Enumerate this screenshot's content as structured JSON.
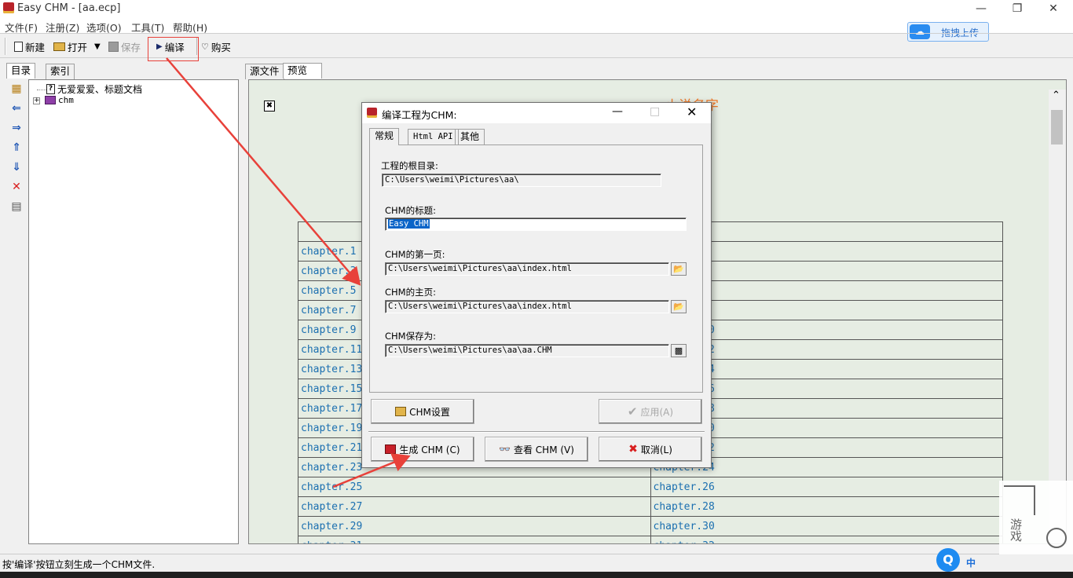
{
  "window": {
    "title": "Easy CHM - [aa.ecp]",
    "min": "—",
    "restore": "❐",
    "close": "✕"
  },
  "menu": [
    "文件(F)",
    "注册(Z)",
    "选项(O)",
    "工具(T)",
    "帮助(H)"
  ],
  "toolbar": {
    "new": "新建",
    "open": "打开",
    "save": "保存",
    "compile": "编译",
    "buy": "购买"
  },
  "baidu": {
    "label": "拖拽上传"
  },
  "left_tabs": [
    "目录",
    "索引"
  ],
  "tree": [
    {
      "label": "无爱爱爱、标题文档"
    },
    {
      "label": "chm"
    }
  ],
  "side_icons": [
    "add-page-icon",
    "arrow-left-icon",
    "arrow-right-icon",
    "arrow-up-icon",
    "arrow-down-icon",
    "delete-icon",
    "properties-icon"
  ],
  "preview_tabs": [
    "源文件",
    "预览"
  ],
  "preview": {
    "heading": "小说名字",
    "rows": [
      [
        "chapter.1",
        ""
      ],
      [
        "chapter.3",
        ""
      ],
      [
        "chapter.5",
        ""
      ],
      [
        "chapter.7",
        ""
      ],
      [
        "chapter.9",
        "chapter.10"
      ],
      [
        "chapter.11",
        "chapter.12"
      ],
      [
        "chapter.13",
        "chapter.14"
      ],
      [
        "chapter.15",
        "chapter.16"
      ],
      [
        "chapter.17",
        "chapter.18"
      ],
      [
        "chapter.19",
        "chapter.20"
      ],
      [
        "chapter.21",
        "chapter.22"
      ],
      [
        "chapter.23",
        "chapter.24"
      ],
      [
        "chapter.25",
        "chapter.26"
      ],
      [
        "chapter.27",
        "chapter.28"
      ],
      [
        "chapter.29",
        "chapter.30"
      ],
      [
        "chapter.31",
        "chapter.32"
      ]
    ]
  },
  "dialog": {
    "title": "编译工程为CHM:",
    "tabs": [
      "常规",
      "Html API",
      "其他"
    ],
    "root_label": "工程的根目录:",
    "root_value": "C:\\Users\\weimi\\Pictures\\aa\\",
    "title_label": "CHM的标题:",
    "title_value": "Easy CHM",
    "first_label": "CHM的第一页:",
    "first_value": "C:\\Users\\weimi\\Pictures\\aa\\index.html",
    "home_label": "CHM的主页:",
    "home_value": "C:\\Users\\weimi\\Pictures\\aa\\index.html",
    "save_label": "CHM保存为:",
    "save_value": "C:\\Users\\weimi\\Pictures\\aa\\aa.CHM",
    "btn_settings": "CHM设置",
    "btn_apply": "应用(A)",
    "btn_build": "生成 CHM (C)",
    "btn_view": "查看 CHM (V)",
    "btn_cancel": "取消(L)"
  },
  "status": "按'编译'按钮立刻生成一个CHM文件.",
  "ime": {
    "lang": "中"
  },
  "watermark": {
    "text": "游戏"
  },
  "colors": {
    "annotation": "#e8413a",
    "link": "#1b6fb0",
    "heading": "#f07a2a",
    "preview_bg": "#e6ede3"
  }
}
